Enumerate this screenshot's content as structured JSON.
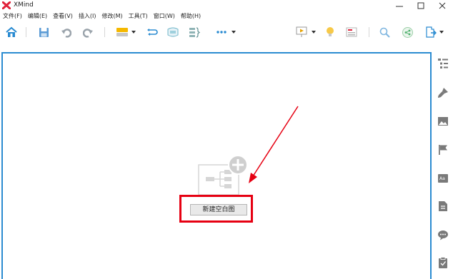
{
  "window": {
    "title": "XMind",
    "controls": [
      "minimize",
      "maximize",
      "close"
    ]
  },
  "menu": {
    "items": [
      "文件(F)",
      "编辑(E)",
      "查看(V)",
      "插入(I)",
      "修改(M)",
      "工具(T)",
      "窗口(W)",
      "帮助(H)"
    ]
  },
  "toolbar": {
    "icons": [
      "home-icon",
      "save-icon",
      "undo-icon",
      "redo-icon",
      "topic-icon",
      "relationship-icon",
      "boundary-icon",
      "summary-icon",
      "more-icon",
      "presentation-icon",
      "idea-icon",
      "outline-icon",
      "search-icon",
      "share-icon",
      "export-icon"
    ]
  },
  "canvas": {
    "new_blank_button": "新建空白图"
  },
  "sidebar": {
    "icons": [
      "outline-panel-icon",
      "format-brush-icon",
      "image-icon",
      "marker-flag-icon",
      "label-icon",
      "notes-icon",
      "comment-icon",
      "task-icon"
    ]
  },
  "colors": {
    "canvas_border": "#2a8bd1",
    "highlight_frame": "#e60012",
    "arrow": "#e60012",
    "toolbar_icon_blue": "#2a8bd1"
  }
}
